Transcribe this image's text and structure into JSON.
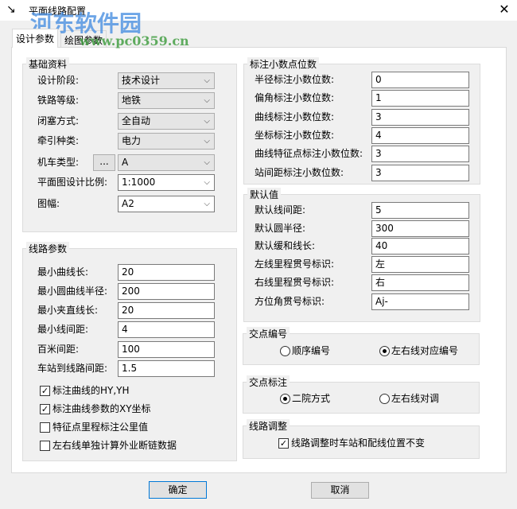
{
  "window": {
    "title": "平面线路配置",
    "close": "✕"
  },
  "watermark": {
    "name": "河东软件园",
    "url": "www.pc0359.cn"
  },
  "tabs": [
    {
      "label": "设计参数"
    },
    {
      "label": "绘图参数"
    }
  ],
  "basic": {
    "title": "基础资料",
    "browse": "...",
    "rows": [
      {
        "label": "设计阶段:",
        "value": "技术设计"
      },
      {
        "label": "铁路等级:",
        "value": "地铁"
      },
      {
        "label": "闭塞方式:",
        "value": "全自动"
      },
      {
        "label": "牵引种类:",
        "value": "电力"
      },
      {
        "label": "机车类型:",
        "value": "A"
      },
      {
        "label": "平面图设计比例:",
        "value": "1:1000"
      },
      {
        "label": "图幅:",
        "value": "A2"
      }
    ]
  },
  "line": {
    "title": "线路参数",
    "rows": [
      {
        "label": "最小曲线长:",
        "value": "20"
      },
      {
        "label": "最小圆曲线半径:",
        "value": "200"
      },
      {
        "label": "最小夹直线长:",
        "value": "20"
      },
      {
        "label": "最小线间距:",
        "value": "4"
      },
      {
        "label": "百米间距:",
        "value": "100"
      },
      {
        "label": "车站到线路间距:",
        "value": "1.5"
      }
    ],
    "checks": [
      {
        "label": "标注曲线的HY,YH",
        "checked": true
      },
      {
        "label": "标注曲线参数的XY坐标",
        "checked": true
      },
      {
        "label": "特征点里程标注公里值",
        "checked": false
      },
      {
        "label": "左右线单独计算外业断链数据",
        "checked": false
      }
    ]
  },
  "decimals": {
    "title": "标注小数点位数",
    "rows": [
      {
        "label": "半径标注小数位数:",
        "value": "0"
      },
      {
        "label": "偏角标注小数位数:",
        "value": "1"
      },
      {
        "label": "曲线标注小数位数:",
        "value": "3"
      },
      {
        "label": "坐标标注小数位数:",
        "value": "4"
      },
      {
        "label": "曲线特征点标注小数位数:",
        "value": "3"
      },
      {
        "label": "站间距标注小数位数:",
        "value": "3"
      }
    ]
  },
  "defaults": {
    "title": "默认值",
    "rows": [
      {
        "label": "默认线间距:",
        "value": "5"
      },
      {
        "label": "默认圆半径:",
        "value": "300"
      },
      {
        "label": "默认缓和线长:",
        "value": "40"
      },
      {
        "label": "左线里程贯号标识:",
        "value": "左"
      },
      {
        "label": "右线里程贯号标识:",
        "value": "右"
      },
      {
        "label": "方位角贯号标识:",
        "value": "Aj-"
      }
    ]
  },
  "jd_number": {
    "title": "交点编号",
    "options": [
      {
        "label": "顺序编号",
        "selected": false
      },
      {
        "label": "左右线对应编号",
        "selected": true
      }
    ]
  },
  "jd_label": {
    "title": "交点标注",
    "options": [
      {
        "label": "二院方式",
        "selected": true
      },
      {
        "label": "左右线对调",
        "selected": false
      }
    ]
  },
  "adjust": {
    "title": "线路调整",
    "check": {
      "label": "线路调整时车站和配线位置不变",
      "checked": true
    }
  },
  "buttons": {
    "ok": "确定",
    "cancel": "取消"
  }
}
